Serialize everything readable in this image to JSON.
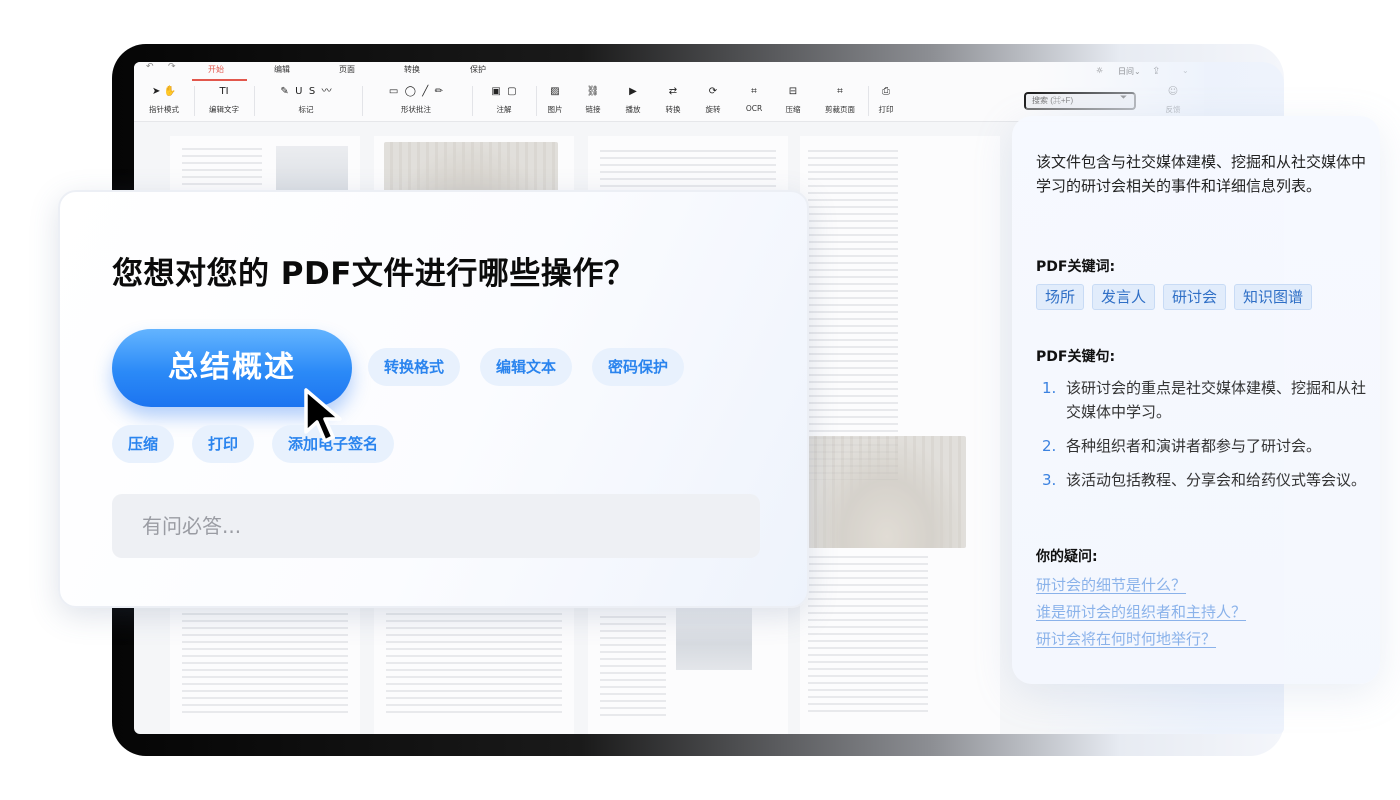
{
  "toolbar": {
    "undo_icon": "undo-icon",
    "redo_icon": "redo-icon",
    "tabs": [
      "开始",
      "编辑",
      "页面",
      "转换",
      "保护"
    ],
    "active_tab": "开始",
    "view_label": "日间",
    "search_placeholder": "搜索 (⌘+F)",
    "groups": [
      "指针模式",
      "编辑文字",
      "标记",
      "形状批注",
      "注解",
      "图片",
      "链接",
      "播放",
      "转换",
      "旋转",
      "OCR",
      "压缩",
      "剪裁页面",
      "打印",
      "反馈"
    ]
  },
  "dialog": {
    "title": "您想对您的 PDF文件进行哪些操作？",
    "primary_action": "总结概述",
    "chips": [
      "转换格式",
      "编辑文本",
      "密码保护",
      "压缩",
      "打印",
      "添加电子签名"
    ],
    "input_placeholder": "有问必答..."
  },
  "info_panel": {
    "intro": "该文件包含与社交媒体建模、挖掘和从社交媒体中学习的研讨会相关的事件和详细信息列表。",
    "keywords_heading": "PDF关键词:",
    "keywords": [
      "场所",
      "发言人",
      "研讨会",
      "知识图谱"
    ],
    "sentences_heading": "PDF关键句:",
    "sentences": [
      {
        "num": "1.",
        "text": "该研讨会的重点是社交媒体建模、挖掘和从社交媒体中学习。"
      },
      {
        "num": "2.",
        "text": "各种组织者和演讲者都参与了研讨会。"
      },
      {
        "num": "3.",
        "text": "该活动包括教程、分享会和给药仪式等会议。"
      }
    ],
    "questions_heading": "你的疑问:",
    "questions": [
      "研讨会的细节是什么？",
      "谁是研讨会的组织者和主持人？",
      "研讨会将在何时何地举行？"
    ]
  },
  "colors": {
    "accent": "#2b8af7",
    "chip_bg": "#e8f1fd",
    "active_tab": "#e2574c",
    "link": "#8ab2ea"
  }
}
